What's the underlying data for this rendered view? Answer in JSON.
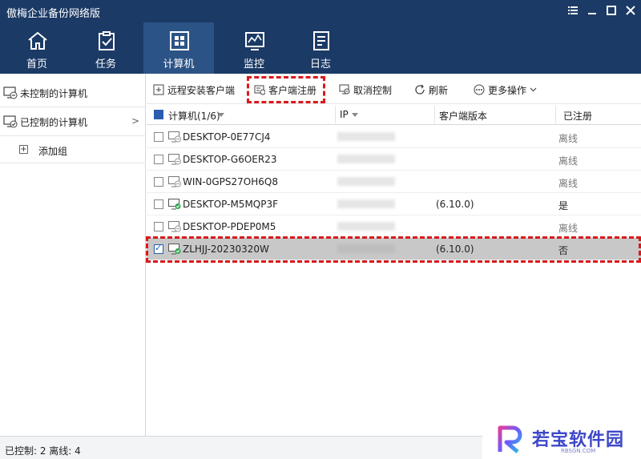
{
  "app": {
    "title": "傲梅企业备份网络版"
  },
  "nav": {
    "tabs": [
      {
        "label": "首页",
        "icon": "home-icon"
      },
      {
        "label": "任务",
        "icon": "task-clipboard-icon"
      },
      {
        "label": "计算机",
        "icon": "windows-icon"
      },
      {
        "label": "监控",
        "icon": "monitor-chart-icon"
      },
      {
        "label": "日志",
        "icon": "log-icon"
      }
    ]
  },
  "sidebar": {
    "items": [
      {
        "label": "未控制的计算机"
      },
      {
        "label": "已控制的计算机",
        "chevron": ">"
      }
    ],
    "add_group": {
      "plus": "+",
      "label": "添加组"
    }
  },
  "toolbar": {
    "remote_install": "远程安装客户端",
    "client_register": "客户端注册",
    "cancel_control": "取消控制",
    "refresh": "刷新",
    "more_actions": "更多操作"
  },
  "table": {
    "headers": {
      "computer": "计算机(1/6)",
      "ip": "IP",
      "client_version": "客户端版本",
      "registered": "已注册"
    },
    "rows": [
      {
        "name": "DESKTOP-0E77CJ4",
        "version": "",
        "status": "离线",
        "online": false,
        "checked": false
      },
      {
        "name": "DESKTOP-G6OER23",
        "version": "",
        "status": "离线",
        "online": false,
        "checked": false
      },
      {
        "name": "WIN-0GPS27OH6Q8",
        "version": "",
        "status": "离线",
        "online": false,
        "checked": false
      },
      {
        "name": "DESKTOP-M5MQP3F",
        "version": "(6.10.0)",
        "status": "是",
        "online": true,
        "checked": false
      },
      {
        "name": "DESKTOP-PDEP0M5",
        "version": "",
        "status": "离线",
        "online": false,
        "checked": false
      },
      {
        "name": "ZLHJJ-20230320W",
        "version": "(6.10.0)",
        "status": "否",
        "online": true,
        "checked": true
      }
    ]
  },
  "status": {
    "text": "已控制: 2 离线: 4"
  },
  "watermark": {
    "text": "若宝软件园",
    "sub": "RBSGN.COM"
  },
  "colors": {
    "nav_bg": "#1b3a66",
    "nav_active": "#2c5386",
    "highlight": "#d9191c",
    "online_green": "#2fa84f"
  }
}
